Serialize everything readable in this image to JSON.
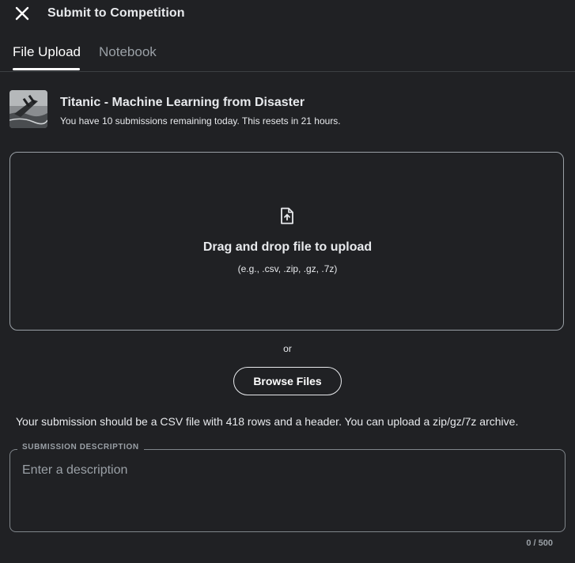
{
  "header": {
    "close_icon": "close-icon",
    "title": "Submit to Competition"
  },
  "tabs": [
    {
      "label": "File Upload",
      "active": true
    },
    {
      "label": "Notebook",
      "active": false
    }
  ],
  "competition": {
    "title": "Titanic - Machine Learning from Disaster",
    "subtitle": "You have 10 submissions remaining today. This resets in 21 hours.",
    "thumbnail_icon": "titanic-thumbnail"
  },
  "dropzone": {
    "icon": "file-upload-icon",
    "title": "Drag and drop file to upload",
    "hint": "(e.g., .csv, .zip, .gz, .7z)"
  },
  "or_label": "or",
  "browse_button": "Browse Files",
  "info": "Your submission should be a CSV file with 418 rows and a header. You can upload a zip/gz/7z archive.",
  "description": {
    "label": "SUBMISSION DESCRIPTION",
    "placeholder": "Enter a description",
    "value": "",
    "counter": "0 / 500"
  },
  "colors": {
    "background": "#202124",
    "text": "#e8eaed",
    "muted": "#9aa0a6",
    "border": "#9aa0a6"
  }
}
